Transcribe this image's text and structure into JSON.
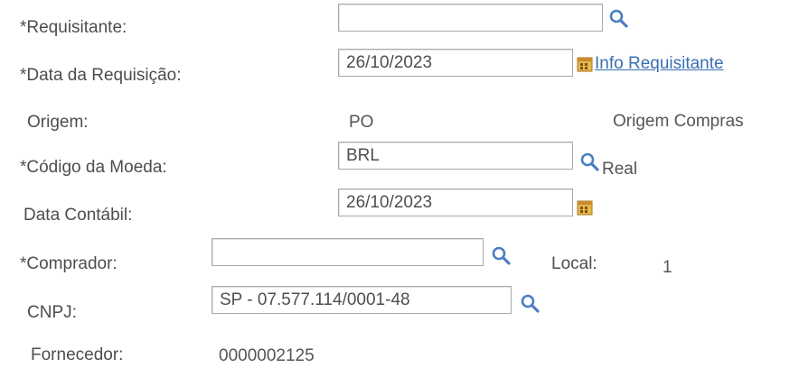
{
  "form": {
    "requisitante": {
      "label": "*Requisitante:",
      "value": ""
    },
    "data_requisicao": {
      "label": "*Data da Requisição:",
      "value": "26/10/2023",
      "link": "Info Requisitante"
    },
    "origem": {
      "label": "Origem:",
      "value": "PO",
      "description": "Origem Compras"
    },
    "codigo_moeda": {
      "label": "*Código da Moeda:",
      "value": "BRL",
      "description": "Real"
    },
    "data_contabil": {
      "label": "Data Contábil:",
      "value": "26/10/2023"
    },
    "comprador": {
      "label": "*Comprador:",
      "value": "",
      "local_label": "Local:",
      "local_value": "1"
    },
    "cnpj": {
      "label": "CNPJ:",
      "value": "SP - 07.577.114/0001-48"
    },
    "fornecedor": {
      "label": "Fornecedor:",
      "value": "0000002125"
    }
  },
  "icons": {
    "lookup": "magnifier-icon",
    "calendar": "calendar-icon"
  },
  "colors": {
    "link": "#3a6fb5",
    "lookup_icon": "#4a7fc1",
    "calendar_icon": "#c9932e"
  }
}
